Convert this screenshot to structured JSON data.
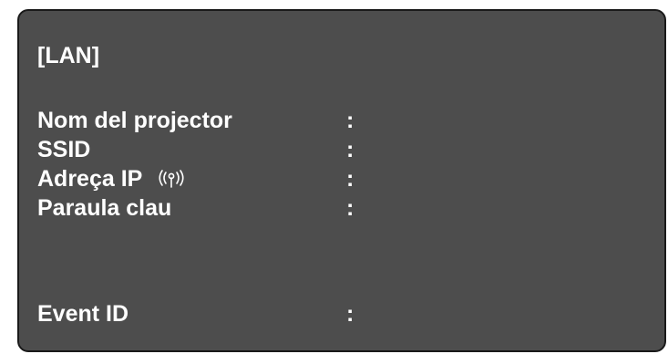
{
  "screen": {
    "title": "[LAN]",
    "rows": [
      {
        "label": "Nom del projector",
        "separator": ":",
        "value": ""
      },
      {
        "label": "SSID",
        "separator": ":",
        "value": ""
      },
      {
        "label": "Adreça IP",
        "icon": "wireless-signal-icon",
        "separator": ":",
        "value": ""
      },
      {
        "label": "Paraula clau",
        "separator": ":",
        "value": ""
      },
      {
        "label": "Event ID",
        "separator": ":",
        "value": ""
      }
    ]
  },
  "colors": {
    "panel_background": "#4d4d4d",
    "panel_border": "#1a1a1a",
    "text": "#ffffff"
  }
}
